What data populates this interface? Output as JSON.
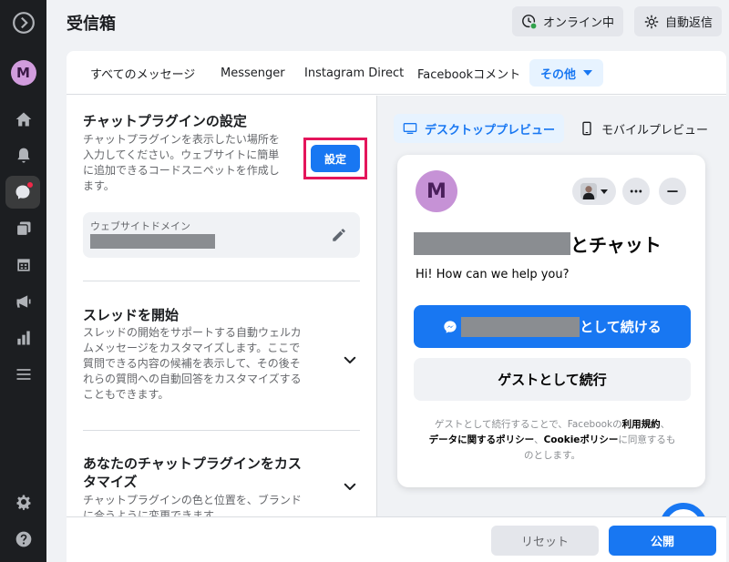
{
  "header": {
    "title": "受信箱",
    "online_label": "オンライン中",
    "auto_reply_label": "自動返信"
  },
  "sidebar": {
    "avatar_initial": "M",
    "icons": [
      "logo-icon",
      "avatar",
      "home-icon",
      "bell-icon",
      "inbox-icon",
      "pages-icon",
      "calendar-icon",
      "megaphone-icon",
      "insights-icon",
      "menu-icon",
      "gear-icon",
      "help-icon"
    ]
  },
  "tabs": [
    {
      "label": "すべてのメッセージ"
    },
    {
      "label": "Messenger"
    },
    {
      "label": "Instagram Direct"
    },
    {
      "label": "Facebookコメント"
    },
    {
      "label": "その他"
    }
  ],
  "chat_plugin": {
    "title": "チャットプラグインの設定",
    "desc_lines": [
      "チャットプラグインを表示したい場所を",
      "入力してください。ウェブサイトに簡単",
      "に追加できるコードスニペットを作成し",
      "ます。"
    ],
    "setup_button": "設定",
    "domain_label": "ウェブサイトドメイン"
  },
  "thread": {
    "title": "スレッドを開始",
    "desc_lines": [
      "スレッドの開始をサポートする自動ウェルカ",
      "ムメッセージをカスタマイズします。ここで",
      "質問できる内容の候補を表示して、その後そ",
      "れらの質問への自動回答をカスタマイズする",
      "こともできます。"
    ]
  },
  "customize": {
    "title_lines": [
      "あなたのチャットプラグインをカス",
      "タマイズ"
    ],
    "desc_lines": [
      "チャットプラグインの色と位置を、ブランド",
      "に合うように変更できます。"
    ]
  },
  "preview": {
    "desktop_tab": "デスクトッププレビュー",
    "mobile_tab": "モバイルプレビュー",
    "widget": {
      "avatar_initial": "M",
      "heading_suffix": "とチャット",
      "greeting": "Hi! How can we help you?",
      "continue_suffix": "として続ける",
      "guest_button": "ゲストとして続行",
      "terms": {
        "t1": "ゲストとして続行することで、Facebookの",
        "b1": "利用規約",
        "t2": "、",
        "b2": "データに関するポリシー",
        "t3": "、",
        "b3": "Cookieポリシー",
        "t4": "に同意するも",
        "t5": "のとします。"
      }
    }
  },
  "footer": {
    "reset_label": "リセット",
    "publish_label": "公開"
  },
  "colors": {
    "accent": "#1877f2",
    "highlight_border": "#e4155b",
    "rail": "#1c1e21",
    "status_online": "#31a24c"
  }
}
